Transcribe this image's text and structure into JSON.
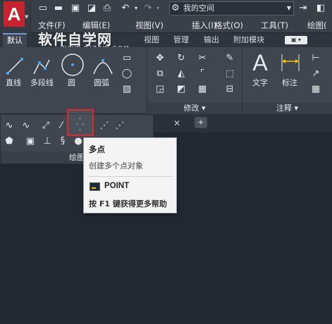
{
  "app": {
    "logo_letter": "A"
  },
  "quick_access": {
    "workspace": "我的空间"
  },
  "menu": [
    "文件(F)",
    "编辑(E)",
    "视图(V)",
    "插入(I)",
    "格式(O)",
    "工具(T)",
    "绘图("
  ],
  "ribbon_tabs": [
    "默认",
    "插",
    "视图",
    "管理",
    "输出",
    "附加模块"
  ],
  "active_tab": "默认",
  "watermark": {
    "main": "软件自学网",
    "sub": "WWW.RJZXW.COM"
  },
  "draw_tools": [
    "直线",
    "多段线",
    "圆",
    "圆弧"
  ],
  "text_tools": [
    "文字",
    "标注"
  ],
  "panels": {
    "modify": "修改 ▾",
    "annotate": "注释 ▾",
    "draw": "绘图"
  },
  "tooltip": {
    "title": "多点",
    "description": "创建多个点对象",
    "command": "POINT",
    "help": "按 F1 键获得更多帮助"
  },
  "colors": {
    "accent_red": "#e2262e",
    "ribbon_bg": "#3f464f",
    "canvas_bg": "#212830"
  }
}
